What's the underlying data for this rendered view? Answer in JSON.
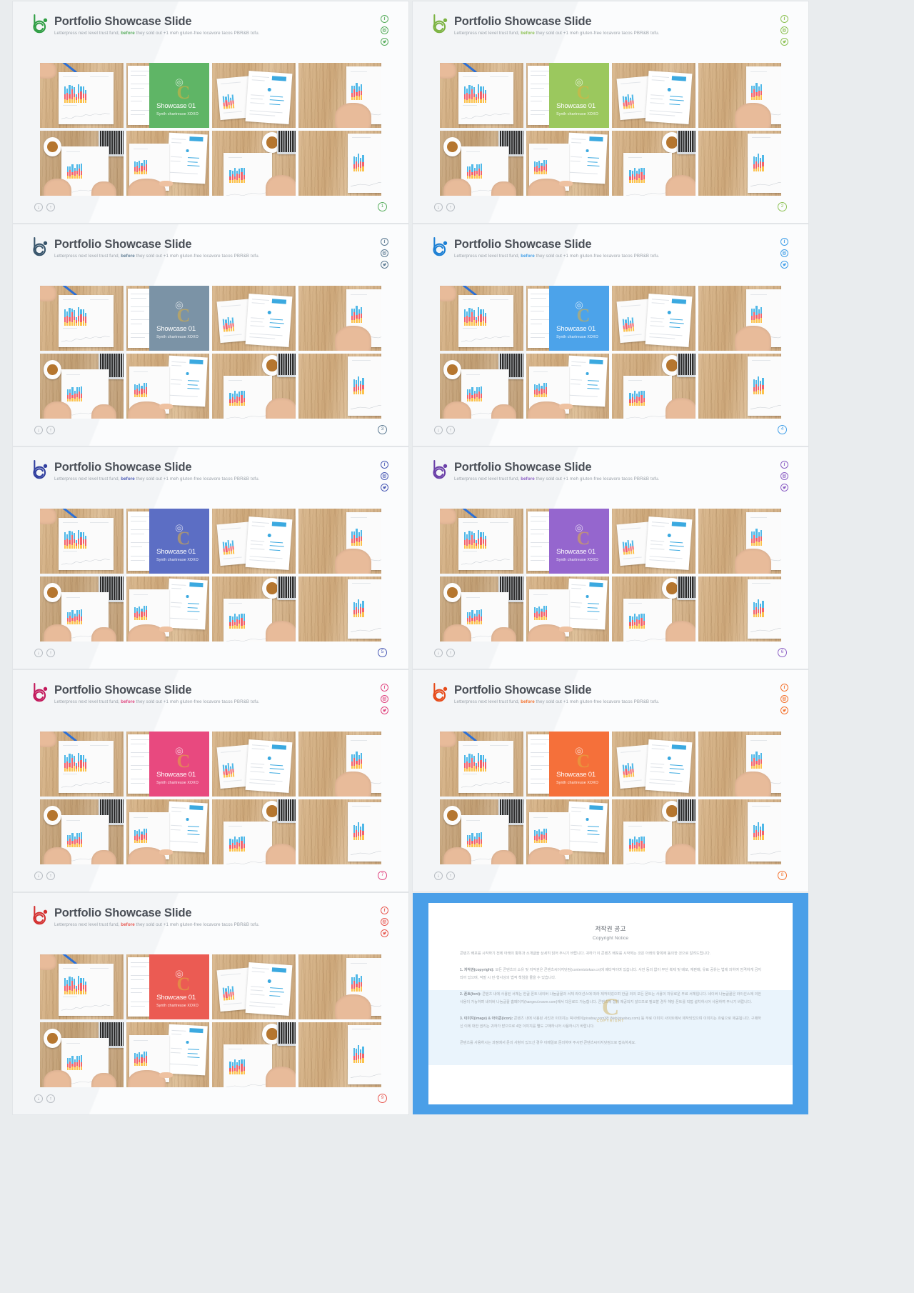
{
  "slides": [
    {
      "title": "Portfolio Showcase Slide",
      "subtitle_pre": "Letterpress next level trust fund, ",
      "subtitle_hl": "before",
      "subtitle_post": " they sold out +1 meh gluten-free locavore tacos PBR&B tofu.",
      "overlay_title": "Showcase 01",
      "overlay_sub": "Synth chartreuse XOXO",
      "page": "1",
      "accent": "#57ad5c",
      "overlay_color": "#5fb566",
      "logo_color": "#2f9e44",
      "watermark": "C"
    },
    {
      "title": "Portfolio Showcase Slide",
      "subtitle_pre": "Letterpress next level trust fund, ",
      "subtitle_hl": "before",
      "subtitle_post": " they sold out +1 meh gluten-free locavore tacos PBR&B tofu.",
      "overlay_title": "Showcase 01",
      "overlay_sub": "Synth chartreuse XOXO",
      "page": "2",
      "accent": "#8cc152",
      "overlay_color": "#9bc85e",
      "logo_color": "#7cb342",
      "watermark": "C"
    },
    {
      "title": "Portfolio Showcase Slide",
      "subtitle_pre": "Letterpress next level trust fund, ",
      "subtitle_hl": "before",
      "subtitle_post": " they sold out +1 meh gluten-free locavore tacos PBR&B tofu.",
      "overlay_title": "Showcase 01",
      "overlay_sub": "Synth chartreuse XOXO",
      "page": "3",
      "accent": "#5d7b93",
      "overlay_color": "#7b93a6",
      "logo_color": "#37546b",
      "watermark": "C"
    },
    {
      "title": "Portfolio Showcase Slide",
      "subtitle_pre": "Letterpress next level trust fund, ",
      "subtitle_hl": "before",
      "subtitle_post": " they sold out +1 meh gluten-free locavore tacos PBR&B tofu.",
      "overlay_title": "Showcase 01",
      "overlay_sub": "Synth chartreuse XOXO",
      "page": "4",
      "accent": "#3f9ee8",
      "overlay_color": "#4ca3ea",
      "logo_color": "#1b7fd4",
      "watermark": "C"
    },
    {
      "title": "Portfolio Showcase Slide",
      "subtitle_pre": "Letterpress next level trust fund, ",
      "subtitle_hl": "before",
      "subtitle_post": " they sold out +1 meh gluten-free locavore tacos PBR&B tofu.",
      "overlay_title": "Showcase 01",
      "overlay_sub": "Synth chartreuse XOXO",
      "page": "5",
      "accent": "#4a5ab5",
      "overlay_color": "#5c6ec4",
      "logo_color": "#303f9f",
      "watermark": "C"
    },
    {
      "title": "Portfolio Showcase Slide",
      "subtitle_pre": "Letterpress next level trust fund, ",
      "subtitle_hl": "before",
      "subtitle_post": " they sold out +1 meh gluten-free locavore tacos PBR&B tofu.",
      "overlay_title": "Showcase 01",
      "overlay_sub": "Synth chartreuse XOXO",
      "page": "6",
      "accent": "#8b5ec4",
      "overlay_color": "#9566ce",
      "logo_color": "#6a3fa8",
      "watermark": "C"
    },
    {
      "title": "Portfolio Showcase Slide",
      "subtitle_pre": "Letterpress next level trust fund, ",
      "subtitle_hl": "before",
      "subtitle_post": " they sold out +1 meh gluten-free locavore tacos PBR&B tofu.",
      "overlay_title": "Showcase 01",
      "overlay_sub": "Synth chartreuse XOXO",
      "page": "7",
      "accent": "#e0447e",
      "overlay_color": "#e8497f",
      "logo_color": "#c2185b",
      "watermark": "C"
    },
    {
      "title": "Portfolio Showcase Slide",
      "subtitle_pre": "Letterpress next level trust fund, ",
      "subtitle_hl": "before",
      "subtitle_post": " they sold out +1 meh gluten-free locavore tacos PBR&B tofu.",
      "overlay_title": "Showcase 01",
      "overlay_sub": "Synth chartreuse XOXO",
      "page": "8",
      "accent": "#f4712c",
      "overlay_color": "#f5703a",
      "logo_color": "#e64a19",
      "watermark": "C"
    },
    {
      "title": "Portfolio Showcase Slide",
      "subtitle_pre": "Letterpress next level trust fund, ",
      "subtitle_hl": "before",
      "subtitle_post": " they sold out +1 meh gluten-free locavore tacos PBR&B tofu.",
      "overlay_title": "Showcase 01",
      "overlay_sub": "Synth chartreuse XOXO",
      "page": "9",
      "accent": "#e8574f",
      "overlay_color": "#eb5b53",
      "logo_color": "#d32f2f",
      "watermark": "C"
    }
  ],
  "nav": {
    "down_icon": "↓",
    "up_icon": "↑"
  },
  "social": {
    "facebook": "f",
    "instagram": "instagram-icon",
    "twitter": "twitter-icon"
  },
  "copyright": {
    "title_ko": "저작권 공고",
    "title_en": "Copyright Notice",
    "watermark": "C",
    "watermark_sub": "COPYRIGHT",
    "paragraphs": [
      "콘텐츠 배포를 시작하기 전에 아래의 항목과 소개글을 상세히 읽어 주시기 바랍니다. 귀하가 이 콘텐츠 배포를 시작하는 것은 아래의 항목에 동의한 것으로 알려드립니다.",
      "<b>1. 저작권(copyright):</b> 모든 콘텐츠의 소유 및 저작권은 콘텐츠씨이지닷컴(contentstokao.cn)에 배타적이며 있습니다. 사전 동의 없이 무단 복제 및 배포, 재판매, 유료 공유는 법에 의하여 엄격하게 금지되어 있으며, 적발 시 민·형사상의 법적 책임을 물을 수 있습니다.",
      "<b>2. 폰트(font):</b> 콘텐츠 내에 사용된 서체는 한글 폰트 네이버 나눔글꼴과 서체 라이선스에 따라 제작되었으며 한글 외의 모든 폰트는 사용이 자유로운 무료 서체입니다. 네이버 나눔글꼴은 라이선스에 의한 사용이 가능하며 네이버 나눔글꼴 홈페이지(hangeul.naver.com)에서 다운로드 가능합니다. 콘텐츠에 함께 제공되지 않으므로 필요할 경우 해당 폰트를 직접 설치하시어 사용하여 주시기 바랍니다.",
      "<b>3. 이미지(image) &amp; 아이콘(icon):</b> 콘텐츠 내에 사용된 사진과 이미지는 픽사베이(pixabay.com)와 Web(pixabay.com) 등 무료 이미지 사이트에서 제작되었으며 이미지는 흐림으로 제공됩니다. 구매하신 이에 대한 권리는 귀하가 받으므로 4번 이미지를 별도 구매하시어 사용하시기 바랍니다.",
      "콘텐츠를 사용하시는 과정에서 문의 사항이 있으신 경우 이메일로 문의하여 주시면 콘텐츠씨이지닷컴으로 접속하세요."
    ]
  }
}
